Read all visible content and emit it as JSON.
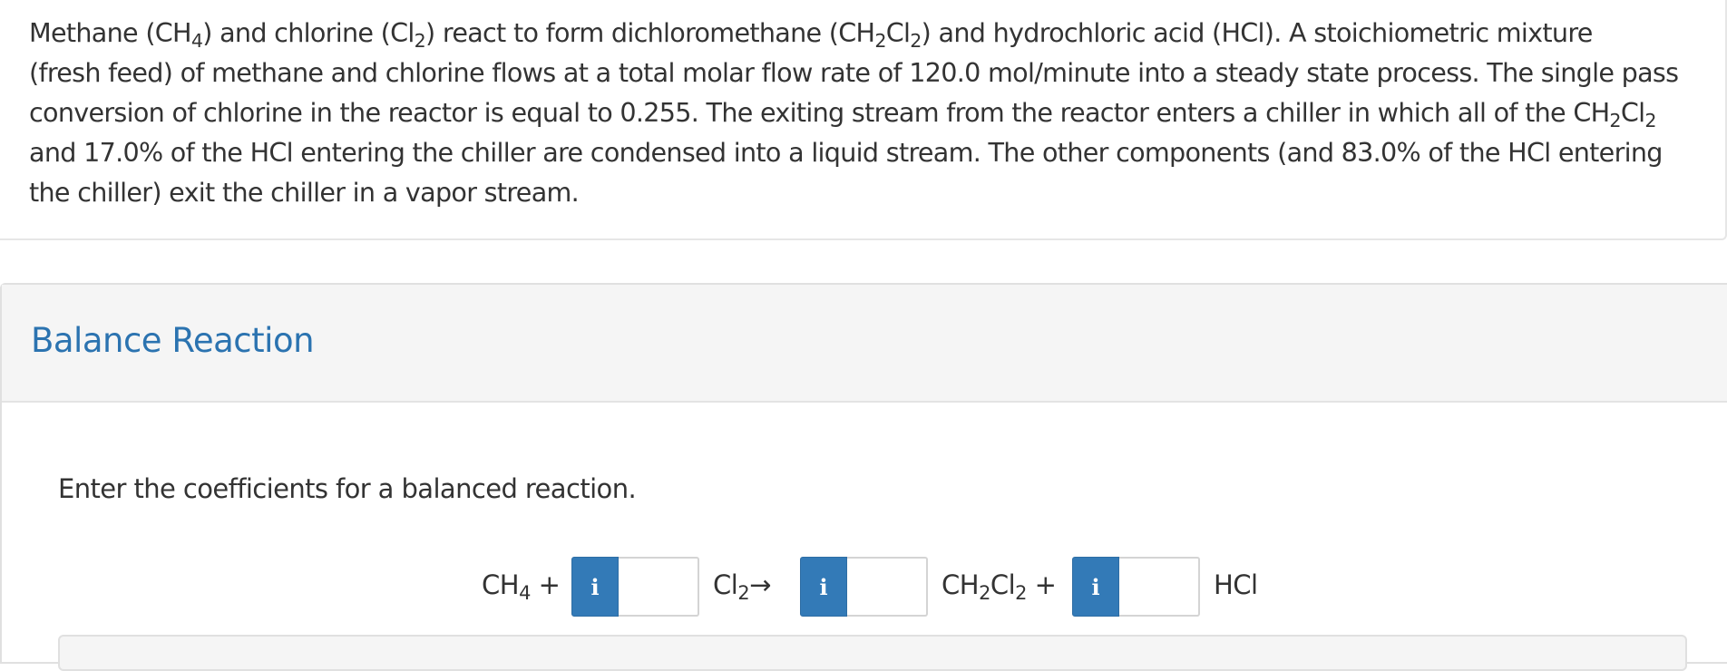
{
  "problem": {
    "line1": {
      "t1": "Methane (CH",
      "s1": "4",
      "t2": ") and chlorine (Cl",
      "s2": "2",
      "t3": ") react to form dichloromethane (CH",
      "s3": "2",
      "t4": "Cl",
      "s4": "2",
      "t5": ") and hydrochloric acid (HCl).  A stoichiometric mixture"
    },
    "line2": "(fresh feed) of methane and chlorine flows at a total molar flow rate of 120.0 mol/minute into a steady state process.  The single pass",
    "line3": {
      "t1": "conversion of chlorine in the reactor is equal to 0.255.  The exiting stream from the reactor enters a chiller in which all of the CH",
      "s1": "2",
      "t2": "Cl",
      "s2": "2"
    },
    "line4": "and 17.0% of the HCl entering the chiller are condensed into a liquid stream.  The other components (and 83.0% of the HCl entering",
    "line5": "the chiller) exit the chiller in a vapor stream."
  },
  "section": {
    "title": "Balance Reaction",
    "instruction": "Enter the coefficients for a balanced reaction."
  },
  "equation": {
    "ch4": {
      "base": "CH",
      "sub": "4",
      "op": " +"
    },
    "cl2": {
      "base": "Cl",
      "sub": "2",
      "op": "→"
    },
    "ch2cl2": {
      "b1": "CH",
      "s1": "2",
      "b2": "Cl",
      "s2": "2",
      "op": " +"
    },
    "hcl": "HCl",
    "info_label": "i",
    "coefficients": [
      "",
      "",
      ""
    ],
    "info_color": "#337ab7"
  }
}
